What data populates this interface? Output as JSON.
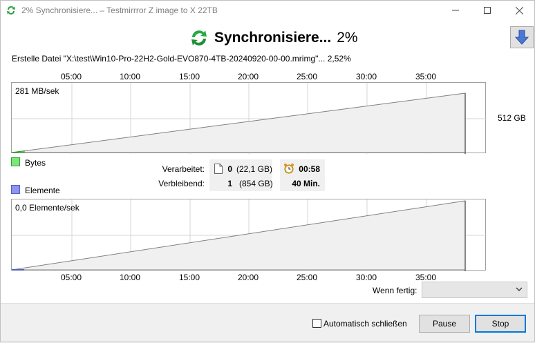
{
  "window": {
    "title": "2% Synchronisiere... – Testmirrror Z image to X 22TB",
    "controls": [
      "minimize",
      "maximize",
      "close"
    ]
  },
  "status": {
    "heading": "Synchronisiere...",
    "percent": "2%",
    "progress_fraction": 0.0252,
    "icon": "sync-arrows-icon",
    "collapse_icon": "arrow-down-icon"
  },
  "current_file": "Erstelle Datei \"X:\\test\\Win10-Pro-22H2-Gold-EVO870-4TB-20240920-00-00.mrimg\"... 2,52%",
  "timeline": {
    "ticks": [
      "05:00",
      "10:00",
      "15:00",
      "20:00",
      "25:00",
      "30:00",
      "35:00"
    ]
  },
  "bytes_chart": {
    "rate": "281 MB/sek",
    "total": "512 GB",
    "legend": "Bytes",
    "legend_color": "#7ce67c",
    "fill_color": "#f0f0f0"
  },
  "items_chart": {
    "rate": "0,0 Elemente/sek",
    "legend": "Elemente",
    "legend_color": "#8c96f0"
  },
  "stats": {
    "processed_label": "Verarbeitet:",
    "remaining_label": "Verbleibend:",
    "processed_count": "0",
    "processed_size": "(22,1 GB)",
    "remaining_count": "1",
    "remaining_size": "(854 GB)",
    "elapsed": "00:58",
    "remaining_time": "40 Min.",
    "file_icon": "file-icon",
    "clock_icon": "alarm-clock-icon"
  },
  "when_done": {
    "label": "Wenn fertig:",
    "value": ""
  },
  "footer": {
    "auto_close_label": "Automatisch schließen",
    "auto_close_checked": false,
    "pause_label": "Pause",
    "stop_label": "Stop"
  }
}
